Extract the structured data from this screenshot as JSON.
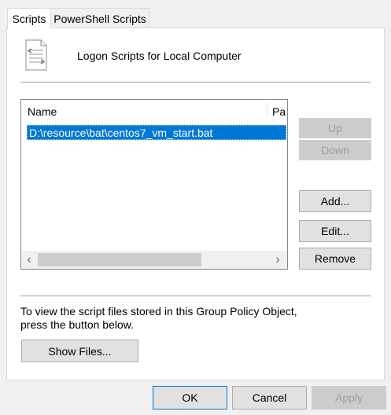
{
  "tabs": [
    {
      "label": "Scripts",
      "active": true
    },
    {
      "label": "PowerShell Scripts",
      "active": false
    }
  ],
  "header": {
    "title": "Logon Scripts for Local Computer",
    "icon": "script-file-icon"
  },
  "list": {
    "columns": [
      "Name",
      "Pa"
    ],
    "rows": [
      {
        "name": "D:\\resource\\bat\\centos7_vm_start.bat",
        "selected": true
      }
    ]
  },
  "side_buttons": {
    "up": "Up",
    "down": "Down",
    "add": "Add...",
    "edit": "Edit...",
    "remove": "Remove"
  },
  "info_text": "To view the script files stored in this Group Policy Object, press the button below.",
  "show_files_label": "Show Files...",
  "footer": {
    "ok": "OK",
    "cancel": "Cancel",
    "apply": "Apply"
  },
  "colors": {
    "selection": "#0078d7",
    "default_border": "#0078d7"
  },
  "scrollbar": {
    "left_arrow": "‹",
    "right_arrow": "›"
  }
}
